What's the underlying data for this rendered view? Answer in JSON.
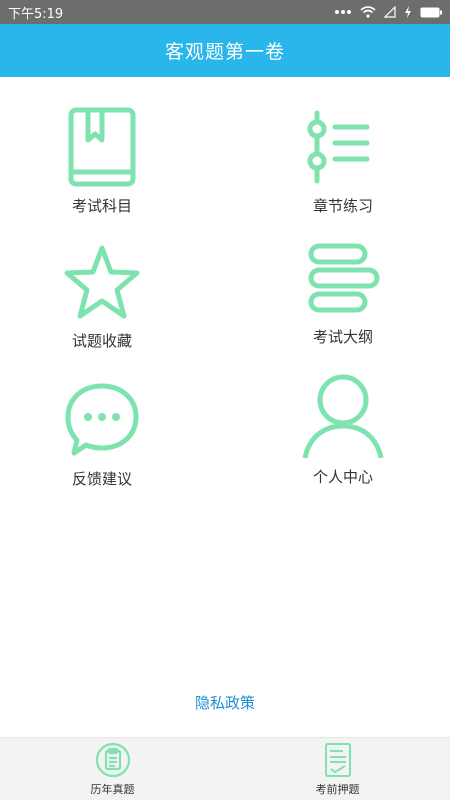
{
  "status_bar": {
    "time": "下午5:19",
    "icons": [
      "dots-icon",
      "wifi-icon",
      "signal-icon",
      "charging-icon",
      "battery-icon"
    ]
  },
  "header": {
    "title": "客观题第一卷"
  },
  "menu": [
    {
      "label": "考试科目",
      "icon": "book-icon"
    },
    {
      "label": "章节练习",
      "icon": "chapter-list-icon"
    },
    {
      "label": "试题收藏",
      "icon": "star-icon"
    },
    {
      "label": "考试大纲",
      "icon": "outline-bars-icon"
    },
    {
      "label": "反馈建议",
      "icon": "chat-bubble-icon"
    },
    {
      "label": "个人中心",
      "icon": "user-icon"
    }
  ],
  "privacy": {
    "label": "隐私政策"
  },
  "bottom_nav": [
    {
      "label": "历年真题",
      "icon": "clipboard-icon"
    },
    {
      "label": "考前押题",
      "icon": "exam-paper-icon"
    }
  ],
  "colors": {
    "accent": "#29b6ea",
    "icon_green": "#7ee3ae",
    "link": "#1e8fd6"
  }
}
